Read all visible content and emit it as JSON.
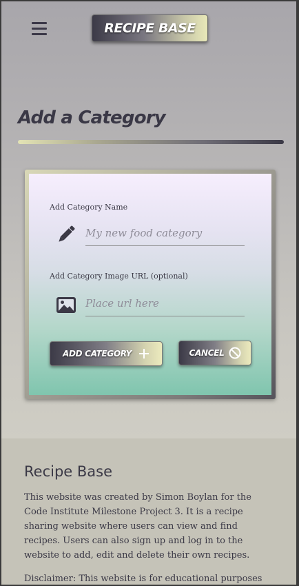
{
  "navbar": {
    "menu_icon": "hamburger-menu-icon",
    "brand": "RECIPE BASE"
  },
  "page": {
    "title": "Add a Category"
  },
  "form": {
    "name_field": {
      "label": "Add Category Name",
      "placeholder": "My new food category",
      "value": "",
      "icon": "pencil-icon"
    },
    "image_field": {
      "label": "Add Category Image URL (optional)",
      "placeholder": "Place url here",
      "value": "",
      "icon": "image-icon"
    },
    "add_button": {
      "label": "ADD CATEGORY",
      "icon": "plus-icon"
    },
    "cancel_button": {
      "label": "CANCEL",
      "icon": "ban-icon"
    }
  },
  "footer": {
    "title": "Recipe Base",
    "about": "This website was created by Simon Boylan for the Code Institute Milestone Project 3. It is a recipe sharing website where users can view and find recipes. Users can also sign up and log in to the website to add, edit and delete their own recipes.",
    "disclaimer": "Disclaimer: This website is for educational purposes only"
  },
  "colors": {
    "text_dark": "#3b3946",
    "accent_light": "#eceabd",
    "accent_dark": "#3c3a47",
    "card_bottom": "#80c5ae"
  }
}
